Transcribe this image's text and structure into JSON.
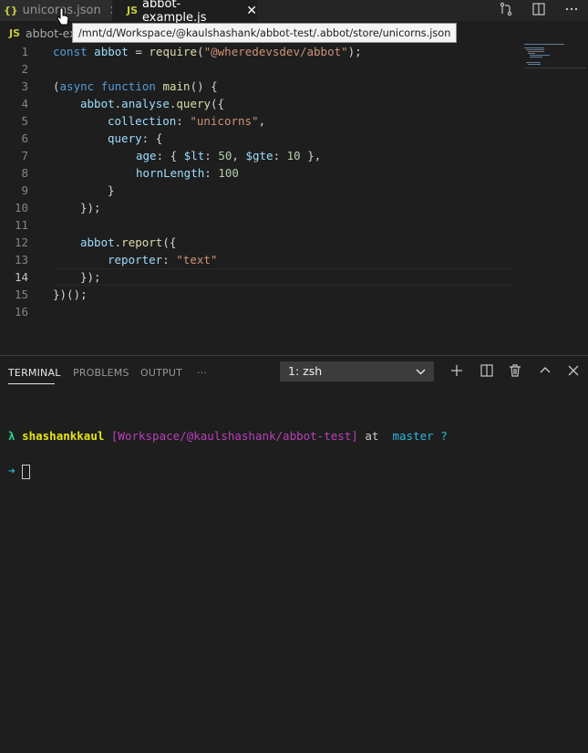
{
  "tabs": [
    {
      "icon": "{}",
      "label": "unicorns.json",
      "close": "✕"
    },
    {
      "icon": "JS",
      "label": "abbot-example.js",
      "close": "✕"
    }
  ],
  "tooltip": "/mnt/d/Workspace/@kaulshashank/abbot-test/.abbot/store/unicorns.json",
  "breadcrumb": {
    "icon": "JS",
    "label": "abbot-ex"
  },
  "editor": {
    "current_line": 14,
    "line_numbers": [
      "1",
      "2",
      "3",
      "4",
      "5",
      "6",
      "7",
      "8",
      "9",
      "10",
      "11",
      "12",
      "13",
      "14",
      "15",
      "16"
    ],
    "code": {
      "l1": {
        "kw": "const",
        "var": "abbot",
        "op": " = ",
        "fn": "require",
        "p1": "(",
        "str": "\"@wheredevsdev/abbot\"",
        "p2": ");"
      },
      "l3": {
        "p1": "(",
        "kw1": "async",
        "kw2": "function",
        "fn": "main",
        "p2": "() {"
      },
      "l4": {
        "var": "abbot",
        "dot1": ".",
        "var2": "analyse",
        "dot2": ".",
        "fn": "query",
        "p": "({"
      },
      "l5": {
        "var": "collection",
        "p1": ": ",
        "str": "\"unicorns\"",
        "p2": ","
      },
      "l6": {
        "var": "query",
        "p": ": {"
      },
      "l7": {
        "var1": "age",
        "p1": ": { ",
        "var2": "$lt",
        "p2": ": ",
        "num1": "50",
        "p3": ", ",
        "var3": "$gte",
        "p4": ": ",
        "num2": "10",
        "p5": " },"
      },
      "l8": {
        "var": "hornLength",
        "p": ": ",
        "num": "100"
      },
      "l9": {
        "p": "}"
      },
      "l10": {
        "p": "});"
      },
      "l12": {
        "var": "abbot",
        "dot": ".",
        "fn": "report",
        "p": "({"
      },
      "l13": {
        "var": "reporter",
        "p": ": ",
        "str": "\"text\""
      },
      "l14": {
        "p": "});"
      },
      "l15": {
        "p": "})();"
      }
    }
  },
  "panel": {
    "tabs": [
      "TERMINAL",
      "PROBLEMS",
      "OUTPUT",
      "···"
    ],
    "terminal_select": "1: zsh",
    "icons": [
      "plus-icon",
      "split-icon",
      "trash-icon",
      "chevron-up-icon",
      "close-icon"
    ]
  },
  "terminal": {
    "lambda": "λ",
    "user": "shashankkaul",
    "path": "[Workspace/@kaulshashank/abbot-test]",
    "at": "at",
    "branch_icon": "",
    "branch": "master",
    "status": "?",
    "arrow": "➜"
  },
  "colors": {
    "keyword": "#569cd6",
    "variable": "#9cdcfe",
    "function": "#dcdcaa",
    "string": "#ce9178",
    "number": "#b5cea8"
  }
}
